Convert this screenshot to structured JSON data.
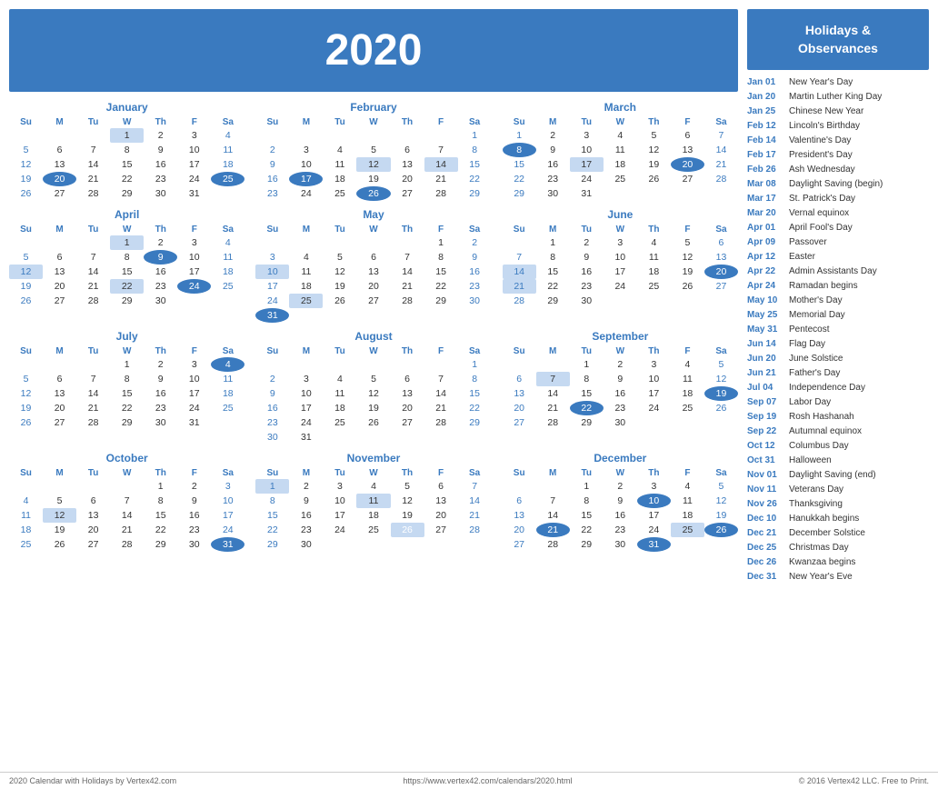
{
  "header": {
    "year": "2020"
  },
  "holidays_header": "Holidays &\nObservances",
  "holidays": [
    {
      "date": "Jan 01",
      "name": "New Year's Day"
    },
    {
      "date": "Jan 20",
      "name": "Martin Luther King Day"
    },
    {
      "date": "Jan 25",
      "name": "Chinese New Year"
    },
    {
      "date": "Feb 12",
      "name": "Lincoln's Birthday"
    },
    {
      "date": "Feb 14",
      "name": "Valentine's Day"
    },
    {
      "date": "Feb 17",
      "name": "President's Day"
    },
    {
      "date": "Feb 26",
      "name": "Ash Wednesday"
    },
    {
      "date": "Mar 08",
      "name": "Daylight Saving (begin)"
    },
    {
      "date": "Mar 17",
      "name": "St. Patrick's Day"
    },
    {
      "date": "Mar 20",
      "name": "Vernal equinox"
    },
    {
      "date": "Apr 01",
      "name": "April Fool's Day"
    },
    {
      "date": "Apr 09",
      "name": "Passover"
    },
    {
      "date": "Apr 12",
      "name": "Easter"
    },
    {
      "date": "Apr 22",
      "name": "Admin Assistants Day"
    },
    {
      "date": "Apr 24",
      "name": "Ramadan begins"
    },
    {
      "date": "May 10",
      "name": "Mother's Day"
    },
    {
      "date": "May 25",
      "name": "Memorial Day"
    },
    {
      "date": "May 31",
      "name": "Pentecost"
    },
    {
      "date": "Jun 14",
      "name": "Flag Day"
    },
    {
      "date": "Jun 20",
      "name": "June Solstice"
    },
    {
      "date": "Jun 21",
      "name": "Father's Day"
    },
    {
      "date": "Jul 04",
      "name": "Independence Day"
    },
    {
      "date": "Sep 07",
      "name": "Labor Day"
    },
    {
      "date": "Sep 19",
      "name": "Rosh Hashanah"
    },
    {
      "date": "Sep 22",
      "name": "Autumnal equinox"
    },
    {
      "date": "Oct 12",
      "name": "Columbus Day"
    },
    {
      "date": "Oct 31",
      "name": "Halloween"
    },
    {
      "date": "Nov 01",
      "name": "Daylight Saving (end)"
    },
    {
      "date": "Nov 11",
      "name": "Veterans Day"
    },
    {
      "date": "Nov 26",
      "name": "Thanksgiving"
    },
    {
      "date": "Dec 10",
      "name": "Hanukkah begins"
    },
    {
      "date": "Dec 21",
      "name": "December Solstice"
    },
    {
      "date": "Dec 25",
      "name": "Christmas Day"
    },
    {
      "date": "Dec 26",
      "name": "Kwanzaa begins"
    },
    {
      "date": "Dec 31",
      "name": "New Year's Eve"
    }
  ],
  "footer": {
    "left": "2020 Calendar with Holidays by Vertex42.com",
    "center": "https://www.vertex42.com/calendars/2020.html",
    "right": "© 2016 Vertex42 LLC. Free to Print."
  },
  "months": [
    {
      "name": "January",
      "weeks": [
        [
          null,
          null,
          null,
          "1",
          "2",
          "3",
          "4"
        ],
        [
          "5",
          "6",
          "7",
          "8",
          "9",
          "10",
          "11"
        ],
        [
          "12",
          "13",
          "14",
          "15",
          "16",
          "17",
          "18"
        ],
        [
          "19",
          "20",
          "21",
          "22",
          "23",
          "24",
          "25"
        ],
        [
          "26",
          "27",
          "28",
          "29",
          "30",
          "31",
          null
        ]
      ],
      "highlights": [
        "1"
      ],
      "blue_highlights": [
        "20",
        "25"
      ]
    },
    {
      "name": "February",
      "weeks": [
        [
          null,
          null,
          null,
          null,
          null,
          null,
          "1"
        ],
        [
          "2",
          "3",
          "4",
          "5",
          "6",
          "7",
          "8"
        ],
        [
          "9",
          "10",
          "11",
          "12",
          "13",
          "14",
          "15"
        ],
        [
          "16",
          "17",
          "18",
          "19",
          "20",
          "21",
          "22"
        ],
        [
          "23",
          "24",
          "25",
          "26",
          "27",
          "28",
          "29"
        ]
      ],
      "highlights": [
        "12",
        "14"
      ],
      "blue_highlights": [
        "17",
        "26"
      ]
    },
    {
      "name": "March",
      "weeks": [
        [
          "1",
          "2",
          "3",
          "4",
          "5",
          "6",
          "7"
        ],
        [
          "8",
          "9",
          "10",
          "11",
          "12",
          "13",
          "14"
        ],
        [
          "15",
          "16",
          "17",
          "18",
          "19",
          "20",
          "21"
        ],
        [
          "22",
          "23",
          "24",
          "25",
          "26",
          "27",
          "28"
        ],
        [
          "29",
          "30",
          "31",
          null,
          null,
          null,
          null
        ]
      ],
      "highlights": [
        "17"
      ],
      "blue_highlights": [
        "8",
        "20"
      ]
    },
    {
      "name": "April",
      "weeks": [
        [
          null,
          null,
          null,
          "1",
          "2",
          "3",
          "4"
        ],
        [
          "5",
          "6",
          "7",
          "8",
          "9",
          "10",
          "11"
        ],
        [
          "12",
          "13",
          "14",
          "15",
          "16",
          "17",
          "18"
        ],
        [
          "19",
          "20",
          "21",
          "22",
          "23",
          "24",
          "25"
        ],
        [
          "26",
          "27",
          "28",
          "29",
          "30",
          null,
          null
        ]
      ],
      "highlights": [
        "1",
        "12",
        "22"
      ],
      "blue_highlights": [
        "9",
        "24"
      ]
    },
    {
      "name": "May",
      "weeks": [
        [
          null,
          null,
          null,
          null,
          null,
          "1",
          "2"
        ],
        [
          "3",
          "4",
          "5",
          "6",
          "7",
          "8",
          "9"
        ],
        [
          "10",
          "11",
          "12",
          "13",
          "14",
          "15",
          "16"
        ],
        [
          "17",
          "18",
          "19",
          "20",
          "21",
          "22",
          "23"
        ],
        [
          "24",
          "25",
          "26",
          "27",
          "28",
          "29",
          "30"
        ],
        [
          "31",
          null,
          null,
          null,
          null,
          null,
          null
        ]
      ],
      "highlights": [
        "10",
        "25"
      ],
      "blue_highlights": [
        "31"
      ]
    },
    {
      "name": "June",
      "weeks": [
        [
          null,
          "1",
          "2",
          "3",
          "4",
          "5",
          "6"
        ],
        [
          "7",
          "8",
          "9",
          "10",
          "11",
          "12",
          "13"
        ],
        [
          "14",
          "15",
          "16",
          "17",
          "18",
          "19",
          "20"
        ],
        [
          "21",
          "22",
          "23",
          "24",
          "25",
          "26",
          "27"
        ],
        [
          "28",
          "29",
          "30",
          null,
          null,
          null,
          null
        ]
      ],
      "highlights": [
        "14",
        "21"
      ],
      "blue_highlights": [
        "20"
      ]
    },
    {
      "name": "July",
      "weeks": [
        [
          null,
          null,
          null,
          "1",
          "2",
          "3",
          "4"
        ],
        [
          "5",
          "6",
          "7",
          "8",
          "9",
          "10",
          "11"
        ],
        [
          "12",
          "13",
          "14",
          "15",
          "16",
          "17",
          "18"
        ],
        [
          "19",
          "20",
          "21",
          "22",
          "23",
          "24",
          "25"
        ],
        [
          "26",
          "27",
          "28",
          "29",
          "30",
          "31",
          null
        ]
      ],
      "highlights": [],
      "blue_highlights": [
        "4"
      ]
    },
    {
      "name": "August",
      "weeks": [
        [
          null,
          null,
          null,
          null,
          null,
          null,
          "1"
        ],
        [
          "2",
          "3",
          "4",
          "5",
          "6",
          "7",
          "8"
        ],
        [
          "9",
          "10",
          "11",
          "12",
          "13",
          "14",
          "15"
        ],
        [
          "16",
          "17",
          "18",
          "19",
          "20",
          "21",
          "22"
        ],
        [
          "23",
          "24",
          "25",
          "26",
          "27",
          "28",
          "29"
        ],
        [
          "30",
          "31",
          null,
          null,
          null,
          null,
          null
        ]
      ],
      "highlights": [],
      "blue_highlights": []
    },
    {
      "name": "September",
      "weeks": [
        [
          null,
          null,
          "1",
          "2",
          "3",
          "4",
          "5"
        ],
        [
          "6",
          "7",
          "8",
          "9",
          "10",
          "11",
          "12"
        ],
        [
          "13",
          "14",
          "15",
          "16",
          "17",
          "18",
          "19"
        ],
        [
          "20",
          "21",
          "22",
          "23",
          "24",
          "25",
          "26"
        ],
        [
          "27",
          "28",
          "29",
          "30",
          null,
          null,
          null
        ]
      ],
      "highlights": [
        "7"
      ],
      "blue_highlights": [
        "19",
        "22"
      ]
    },
    {
      "name": "October",
      "weeks": [
        [
          null,
          null,
          null,
          null,
          "1",
          "2",
          "3"
        ],
        [
          "4",
          "5",
          "6",
          "7",
          "8",
          "9",
          "10"
        ],
        [
          "11",
          "12",
          "13",
          "14",
          "15",
          "16",
          "17"
        ],
        [
          "18",
          "19",
          "20",
          "21",
          "22",
          "23",
          "24"
        ],
        [
          "25",
          "26",
          "27",
          "28",
          "29",
          "30",
          "31"
        ]
      ],
      "highlights": [
        "12"
      ],
      "blue_highlights": [
        "31"
      ]
    },
    {
      "name": "November",
      "weeks": [
        [
          "1",
          "2",
          "3",
          "4",
          "5",
          "6",
          "7"
        ],
        [
          "8",
          "9",
          "10",
          "11",
          "12",
          "13",
          "14"
        ],
        [
          "15",
          "16",
          "17",
          "18",
          "19",
          "20",
          "21"
        ],
        [
          "22",
          "23",
          "24",
          "25",
          "26",
          "27",
          "28"
        ],
        [
          "29",
          "30",
          null,
          null,
          null,
          null,
          null
        ]
      ],
      "highlights": [
        "1",
        "11",
        "26"
      ],
      "blue_highlights": [
        "26"
      ]
    },
    {
      "name": "December",
      "weeks": [
        [
          null,
          null,
          "1",
          "2",
          "3",
          "4",
          "5"
        ],
        [
          "6",
          "7",
          "8",
          "9",
          "10",
          "11",
          "12"
        ],
        [
          "13",
          "14",
          "15",
          "16",
          "17",
          "18",
          "19"
        ],
        [
          "20",
          "21",
          "22",
          "23",
          "24",
          "25",
          "26"
        ],
        [
          "27",
          "28",
          "29",
          "30",
          "31",
          null,
          null
        ]
      ],
      "highlights": [
        "25"
      ],
      "blue_highlights": [
        "10",
        "21",
        "26",
        "31"
      ]
    }
  ]
}
